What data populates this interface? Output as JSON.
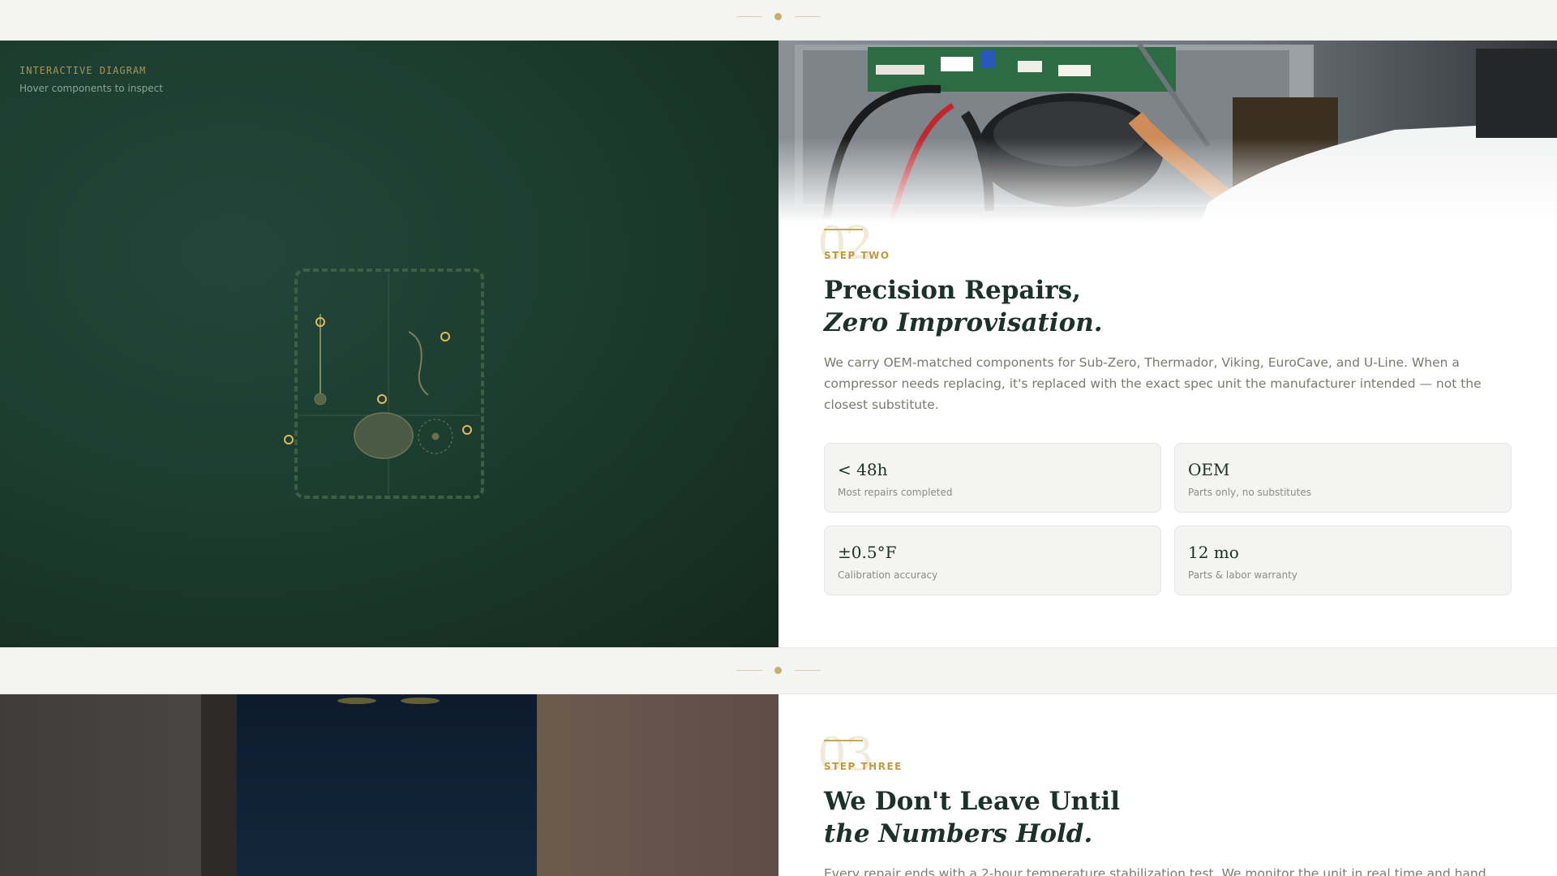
{
  "diagram": {
    "kicker": "INTERACTIVE DIAGRAM",
    "hint": "Hover components to inspect"
  },
  "step_two": {
    "number": "02",
    "label": "STEP TWO",
    "title_line1": "Precision Repairs,",
    "title_line2": "Zero Improvisation.",
    "body": "We carry OEM-matched components for Sub-Zero, Thermador, Viking, EuroCave, and U-Line. When a compressor needs replacing, it's replaced with the exact spec unit the manufacturer intended — not the closest substitute.",
    "stats": [
      {
        "value": "< 48h",
        "label": "Most repairs completed"
      },
      {
        "value": "OEM",
        "label": "Parts only, no substitutes"
      },
      {
        "value": "±0.5°F",
        "label": "Calibration accuracy"
      },
      {
        "value": "12 mo",
        "label": "Parts & labor warranty"
      }
    ]
  },
  "step_three": {
    "number": "03",
    "label": "STEP THREE",
    "title_line1": "We Don't Leave Until",
    "title_line2": "the Numbers Hold.",
    "body": "Every repair ends with a 2-hour temperature stabilization test. We monitor the unit in real time and hand"
  },
  "colors": {
    "accent_gold": "#c9a85c",
    "deep_green": "#1c3d30",
    "ink": "#1c3128"
  }
}
